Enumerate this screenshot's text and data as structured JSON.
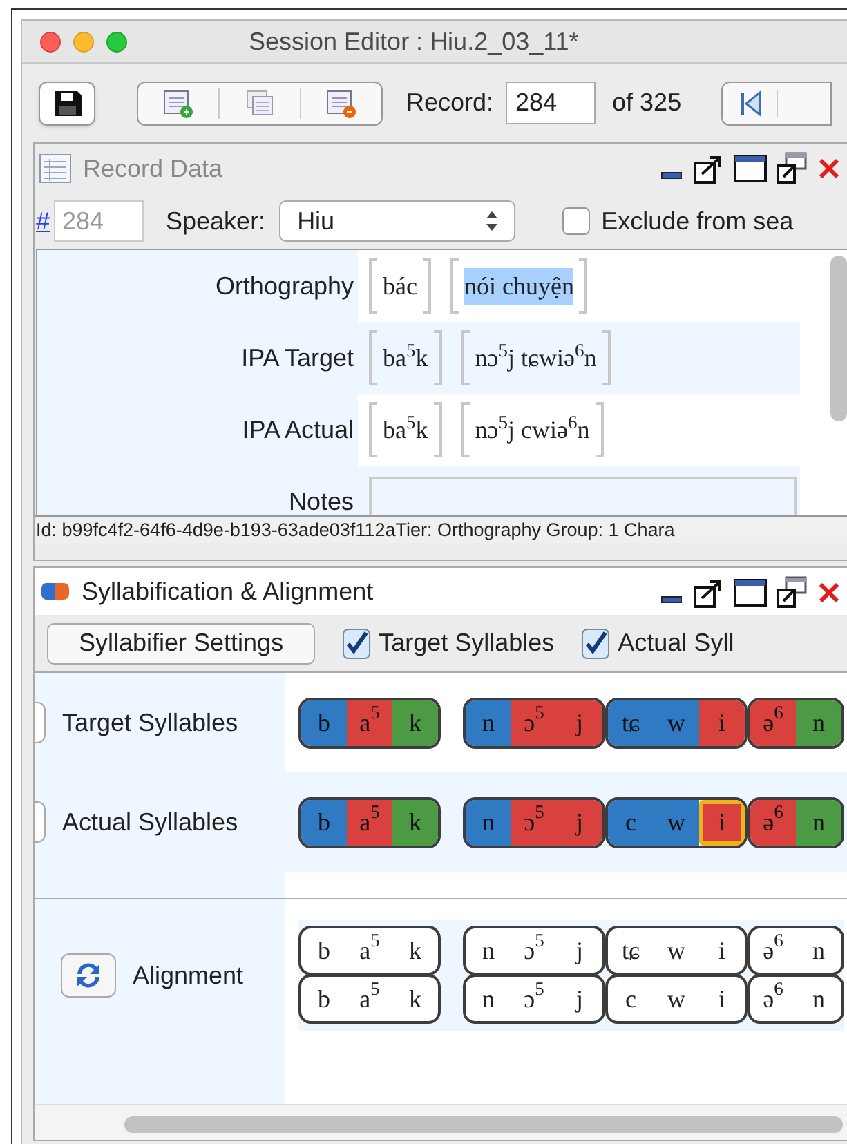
{
  "window": {
    "title": "Session Editor : Hiu.2_03_11*"
  },
  "toolbar": {
    "record_label": "Record:",
    "record_value": "284",
    "record_total": "of 325"
  },
  "record_data": {
    "title": "Record Data",
    "number_link": "#",
    "number_value": "284",
    "speaker_label": "Speaker:",
    "speaker_value": "Hiu",
    "exclude": {
      "label": "Exclude from sea",
      "checked": false
    },
    "tiers": [
      {
        "label": "Orthography",
        "groups": [
          {
            "text": "bác",
            "selected": false
          },
          {
            "text": "nói chuyện",
            "selected": true
          }
        ]
      },
      {
        "label": "IPA Target",
        "groups": [
          {
            "text": "ba$^{5}$k",
            "selected": false
          },
          {
            "text": "nɔ$^{5}$j tɕwiə$^{6}$n",
            "selected": false
          }
        ]
      },
      {
        "label": "IPA Actual",
        "groups": [
          {
            "text": "ba$^{5}$k",
            "selected": false
          },
          {
            "text": "nɔ$^{5}$j cwiə$^{6}$n",
            "selected": false
          }
        ]
      },
      {
        "label": "Notes"
      }
    ],
    "status": "Id: b99fc4f2-64f6-4d9e-b193-63ade03f112aTier: Orthography Group: 1  Chara"
  },
  "syllabification": {
    "title": "Syllabification & Alignment",
    "settings_button": "Syllabifier Settings",
    "toggles": [
      {
        "label": "Target Syllables",
        "checked": true
      },
      {
        "label": "Actual Syll",
        "checked": true
      }
    ],
    "rows": [
      {
        "label": "Target Syllables",
        "words": [
          [
            [
              {
                "text": "b",
                "color": "#2f7ac3"
              },
              {
                "text": "a$^{5}$",
                "color": "#d8413d"
              },
              {
                "text": "k",
                "color": "#4d9a45"
              }
            ]
          ],
          [
            [
              {
                "text": "n",
                "color": "#2f7ac3"
              },
              {
                "text": "ɔ$^{5}$",
                "color": "#d8413d"
              },
              {
                "text": "j",
                "color": "#d8413d"
              }
            ],
            [
              {
                "text": "tɕ",
                "color": "#2f7ac3"
              },
              {
                "text": "w",
                "color": "#2f7ac3"
              },
              {
                "text": "i",
                "color": "#d8413d"
              }
            ],
            [
              {
                "text": "ə$^{6}$",
                "color": "#d8413d"
              },
              {
                "text": "n",
                "color": "#4d9a45"
              }
            ]
          ]
        ]
      },
      {
        "label": "Actual Syllables",
        "words": [
          [
            [
              {
                "text": "b",
                "color": "#2f7ac3"
              },
              {
                "text": "a$^{5}$",
                "color": "#d8413d"
              },
              {
                "text": "k",
                "color": "#4d9a45"
              }
            ]
          ],
          [
            [
              {
                "text": "n",
                "color": "#2f7ac3"
              },
              {
                "text": "ɔ$^{5}$",
                "color": "#d8413d"
              },
              {
                "text": "j",
                "color": "#d8413d"
              }
            ],
            [
              {
                "text": "c",
                "color": "#2f7ac3"
              },
              {
                "text": "w",
                "color": "#2f7ac3"
              },
              {
                "text": "i",
                "color": "#d8413d",
                "highlighted": true
              }
            ],
            [
              {
                "text": "ə$^{6}$",
                "color": "#d8413d"
              },
              {
                "text": "n",
                "color": "#4d9a45"
              }
            ]
          ]
        ]
      }
    ],
    "alignment": {
      "label": "Alignment",
      "words": [
        [
          {
            "target": [
              "b",
              "a$^{5}$",
              "k"
            ],
            "actual": [
              "b",
              "a$^{5}$",
              "k"
            ]
          }
        ],
        [
          {
            "target": [
              "n",
              "ɔ$^{5}$",
              "j"
            ],
            "actual": [
              "n",
              "ɔ$^{5}$",
              "j"
            ]
          },
          {
            "target": [
              "tɕ",
              "w",
              "i"
            ],
            "actual": [
              "c",
              "w",
              "i"
            ]
          },
          {
            "target": [
              "ə$^{6}$",
              "n"
            ],
            "actual": [
              "ə$^{6}$",
              "n"
            ]
          }
        ]
      ]
    }
  }
}
